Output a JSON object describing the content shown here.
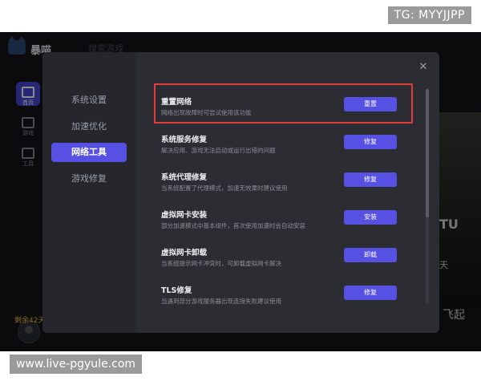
{
  "watermarks": {
    "top": "TG: MYYJJPP",
    "bottom": "www.live-pgyule.com"
  },
  "app": {
    "name": "暴喵",
    "search_text": "搜索游戏",
    "sidebar": [
      {
        "label": "首页",
        "icon": "home-icon",
        "active": true
      },
      {
        "label": "游戏",
        "icon": "game-icon",
        "active": false
      },
      {
        "label": "工具",
        "icon": "tools-icon",
        "active": false
      }
    ],
    "remaining": "剩余42天",
    "promo": {
      "text1": "TU",
      "text2": "天",
      "text3": "飞起"
    }
  },
  "modal": {
    "nav": [
      {
        "label": "系统设置",
        "active": false
      },
      {
        "label": "加速优化",
        "active": false
      },
      {
        "label": "网络工具",
        "active": true
      },
      {
        "label": "游戏修复",
        "active": false
      }
    ],
    "close_icon": "close-icon",
    "accent_color": "#5650e3",
    "highlight_color": "#e23b3b",
    "tools": [
      {
        "title": "重置网络",
        "desc": "网络出现故障时可尝试使用该功能",
        "button": "重置",
        "highlighted": true
      },
      {
        "title": "系统服务修复",
        "desc": "解决应用、游戏无法启动或运行出错的问题",
        "button": "修复",
        "highlighted": false
      },
      {
        "title": "系统代理修复",
        "desc": "当系统配置了代理模式，加速无效果时建议使用",
        "button": "修复",
        "highlighted": false
      },
      {
        "title": "虚拟网卡安装",
        "desc": "部分加速模式中基本组件，首次使用加速时会自动安装",
        "button": "安装",
        "highlighted": false
      },
      {
        "title": "虚拟网卡卸载",
        "desc": "当系统提示网卡冲突时，可卸载虚拟网卡解决",
        "button": "卸载",
        "highlighted": false
      },
      {
        "title": "TLS修复",
        "desc": "当遇到部分游戏服务器出现连接失败建议使用",
        "button": "修复",
        "highlighted": false
      }
    ]
  }
}
